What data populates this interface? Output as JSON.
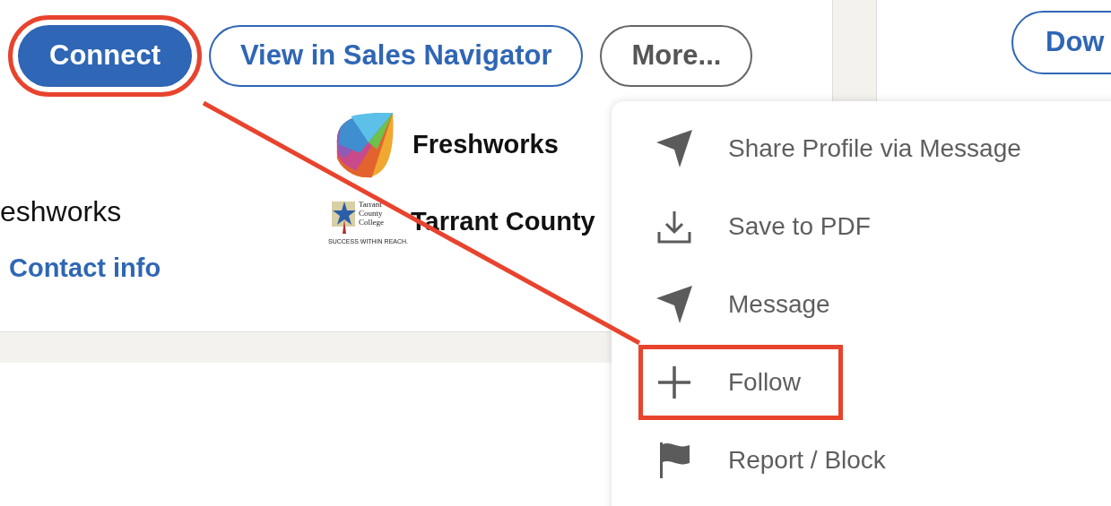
{
  "profile_actions": [
    {
      "label": "Connect",
      "kind": "primary",
      "highlighted": true
    },
    {
      "label": "View in Sales Navigator",
      "kind": "outline",
      "highlighted": false
    },
    {
      "label": "More...",
      "kind": "secondary",
      "highlighted": false
    }
  ],
  "headline_fragment": "eshworks",
  "contact_link": "Contact info",
  "experience": [
    {
      "name": "Freshworks",
      "kind": "freshworks"
    },
    {
      "name": "Tarrant County",
      "kind": "college",
      "logo_text": "Tarrant County College",
      "logo_tagline": "SUCCESS WITHIN REACH."
    }
  ],
  "side_button": "Dow",
  "more_menu": [
    {
      "label": "Share Profile via Message",
      "kind": "send",
      "highlighted": false
    },
    {
      "label": "Save to PDF",
      "kind": "download",
      "highlighted": false
    },
    {
      "label": "Message",
      "kind": "send",
      "highlighted": false
    },
    {
      "label": "Follow",
      "kind": "plus",
      "highlighted": true
    },
    {
      "label": "Report / Block",
      "kind": "flag",
      "highlighted": false
    }
  ]
}
